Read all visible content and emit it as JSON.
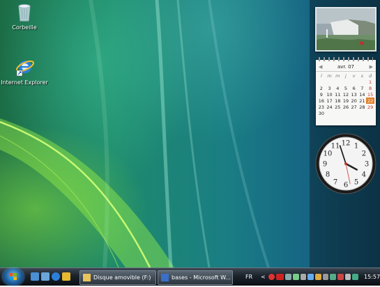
{
  "desktop": {
    "icons": [
      {
        "label": "Corbeille",
        "icon": "recycle-bin-icon"
      },
      {
        "label": "Internet Explorer",
        "icon": "internet-explorer-icon"
      }
    ]
  },
  "sidebar": {
    "calendar": {
      "month": "avr. 07",
      "weekdays": [
        "l",
        "m",
        "m",
        "j",
        "v",
        "s",
        "d"
      ],
      "weeks": [
        [
          "",
          "",
          "",
          "",
          "",
          "",
          "1"
        ],
        [
          "2",
          "3",
          "4",
          "5",
          "6",
          "7",
          "8"
        ],
        [
          "9",
          "10",
          "11",
          "12",
          "13",
          "14",
          "15"
        ],
        [
          "16",
          "17",
          "18",
          "19",
          "20",
          "21",
          "22"
        ],
        [
          "23",
          "24",
          "25",
          "26",
          "27",
          "28",
          "29"
        ],
        [
          "30",
          "",
          "",
          "",
          "",
          "",
          ""
        ]
      ],
      "today": "22"
    },
    "clock": {
      "numerals": [
        "12",
        "1",
        "2",
        "3",
        "4",
        "5",
        "6",
        "7",
        "8",
        "9",
        "10",
        "11"
      ]
    }
  },
  "taskbar": {
    "tasks": [
      {
        "label": "Disque amovible (F:)",
        "icon": "folder-icon"
      },
      {
        "label": "bases - Microsoft W...",
        "icon": "word-document-icon"
      }
    ],
    "tray": {
      "language": "FR",
      "expand_glyph": "<",
      "time": "15:57"
    }
  },
  "colors": {
    "accent_today": "#e0802a",
    "taskbar": "#1a222b"
  }
}
